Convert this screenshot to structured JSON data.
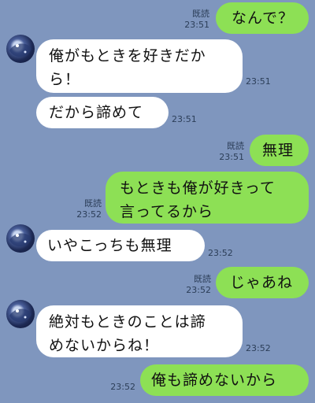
{
  "colors": {
    "background": "#7f96be",
    "outgoing_bubble": "#8de055",
    "incoming_bubble": "#ffffff"
  },
  "messages": [
    {
      "side": "out",
      "text": "なんで？",
      "read": "既読",
      "time": "23:51"
    },
    {
      "side": "in",
      "text": "俺がもときを好きだか\nら！",
      "time": "23:51"
    },
    {
      "side": "in",
      "text": "だから諦めて",
      "time": "23:51"
    },
    {
      "side": "out",
      "text": "無理",
      "read": "既読",
      "time": "23:51"
    },
    {
      "side": "out",
      "text": "もときも俺が好きって\n言ってるから",
      "read": "既読",
      "time": "23:52"
    },
    {
      "side": "in",
      "text": "いやこっちも無理",
      "time": "23:52"
    },
    {
      "side": "out",
      "text": "じゃあね",
      "read": "既読",
      "time": "23:52"
    },
    {
      "side": "in",
      "text": "絶対もときのことは諦\nめないからね！",
      "time": "23:52"
    },
    {
      "side": "out",
      "text": "俺も諦めないから",
      "time": "23:52"
    }
  ]
}
